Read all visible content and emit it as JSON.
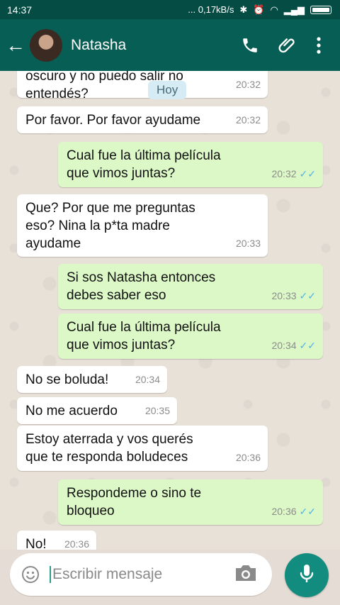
{
  "status": {
    "time": "14:37",
    "indicators": "... 0,17kB/s"
  },
  "header": {
    "back_icon": "arrow-left-icon",
    "contact_name": "Natasha",
    "actions": [
      "phone-icon",
      "paperclip-icon",
      "more-vert-icon"
    ]
  },
  "chat": {
    "date_chip": "Hoy",
    "messages": [
      {
        "dir": "in",
        "text": "oscuro y no puedo salir no\nentendés?",
        "time": "20:32"
      },
      {
        "dir": "in",
        "text": "Por favor. Por favor ayudame",
        "time": "20:32"
      },
      {
        "dir": "out",
        "text": "Cual fue la última película\nque vimos juntas?",
        "time": "20:32"
      },
      {
        "dir": "in",
        "text": "Que? Por que me preguntas\neso? Nina la p*ta madre\nayudame",
        "time": "20:33"
      },
      {
        "dir": "out",
        "text": "Si sos Natasha entonces\ndebes saber eso",
        "time": "20:33"
      },
      {
        "dir": "out",
        "text": "Cual fue la última película\nque vimos juntas?",
        "time": "20:34"
      },
      {
        "dir": "in",
        "text": "No se boluda!",
        "time": "20:34"
      },
      {
        "dir": "in",
        "text": "No me acuerdo",
        "time": "20:35"
      },
      {
        "dir": "in",
        "text": "Estoy aterrada y vos querés\nque te responda boludeces",
        "time": "20:36"
      },
      {
        "dir": "out",
        "text": "Respondeme o sino te\nbloqueo",
        "time": "20:36"
      },
      {
        "dir": "in",
        "text": "No!",
        "time": "20:36"
      }
    ]
  },
  "composer": {
    "placeholder": "Escribir mensaje",
    "emoji_icon": "emoji-icon",
    "camera_icon": "camera-icon",
    "mic_icon": "mic-icon"
  },
  "colors": {
    "appbar": "#075e54",
    "statusbar": "#054d44",
    "outgoing": "#dcf8c6",
    "incoming": "#ffffff",
    "accent": "#128c7e",
    "read_ticks": "#4fb6ec"
  }
}
